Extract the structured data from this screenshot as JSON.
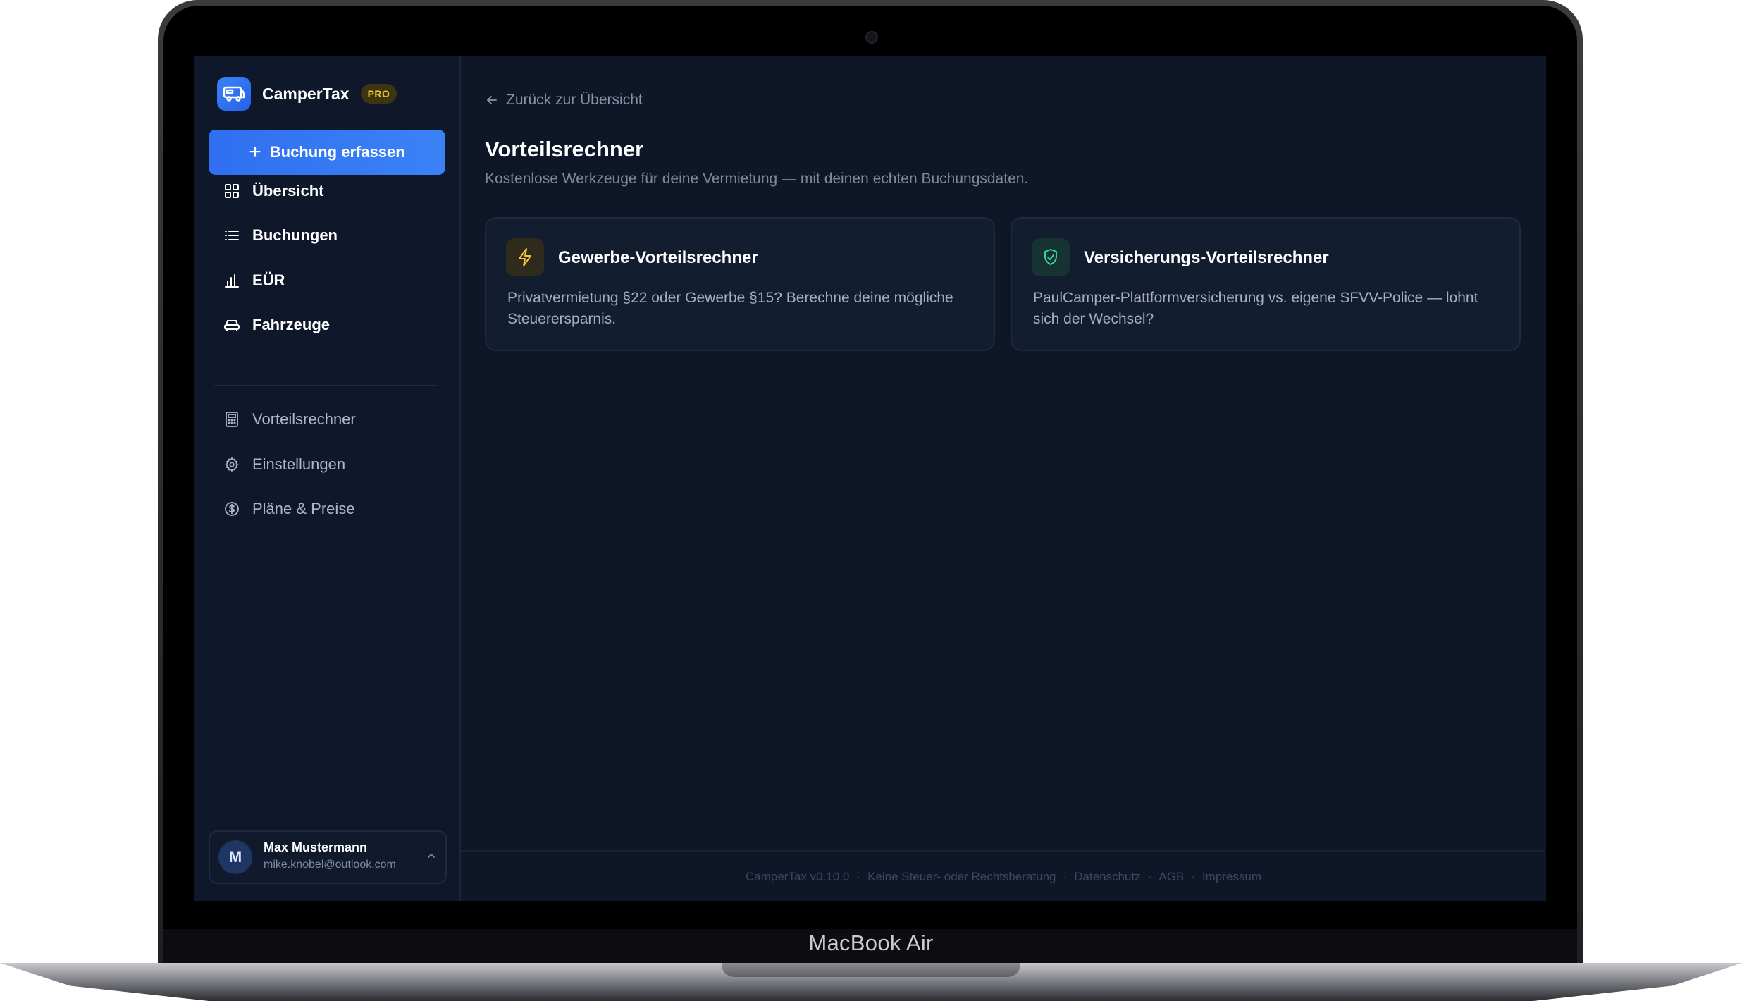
{
  "device": {
    "label": "MacBook Air"
  },
  "app": {
    "name": "CamperTax",
    "badge": "PRO"
  },
  "sidebar": {
    "primary_action": "Buchung erfassen",
    "main_items": [
      {
        "label": "Übersicht",
        "icon": "grid-icon"
      },
      {
        "label": "Buchungen",
        "icon": "list-icon"
      },
      {
        "label": "EÜR",
        "icon": "bar-chart-icon"
      },
      {
        "label": "Fahrzeuge",
        "icon": "car-icon"
      }
    ],
    "secondary_items": [
      {
        "label": "Vorteilsrechner",
        "icon": "calculator-icon"
      },
      {
        "label": "Einstellungen",
        "icon": "gear-icon"
      },
      {
        "label": "Pläne & Preise",
        "icon": "dollar-circle-icon"
      }
    ],
    "user": {
      "initial": "M",
      "name": "Max Mustermann",
      "email": "mike.knobel@outlook.com"
    }
  },
  "main": {
    "back_link": "Zurück zur Übersicht",
    "title": "Vorteilsrechner",
    "subtitle": "Kostenlose Werkzeuge für deine Vermietung — mit deinen echten Buchungsdaten.",
    "cards": [
      {
        "title": "Gewerbe-Vorteilsrechner",
        "description": "Privatvermietung §22 oder Gewerbe §15? Berechne deine mögliche Steuerersparnis.",
        "icon": "lightning-icon",
        "accent": "#f5c53a"
      },
      {
        "title": "Versicherungs-Vorteilsrechner",
        "description": "PaulCamper-Plattformversicherung vs. eigene SFVV-Police — lohnt sich der Wechsel?",
        "icon": "shield-check-icon",
        "accent": "#34d399"
      }
    ]
  },
  "footer": {
    "items": [
      "CamperTax v0.10.0",
      "Keine Steuer- oder Rechtsberatung",
      "Datenschutz",
      "AGB",
      "Impressum"
    ],
    "separator": "·"
  },
  "colors": {
    "background": "#0e1628",
    "sidebar": "#0f182b",
    "primary": "#3b82f6",
    "pro_badge": "#f3c73a"
  }
}
